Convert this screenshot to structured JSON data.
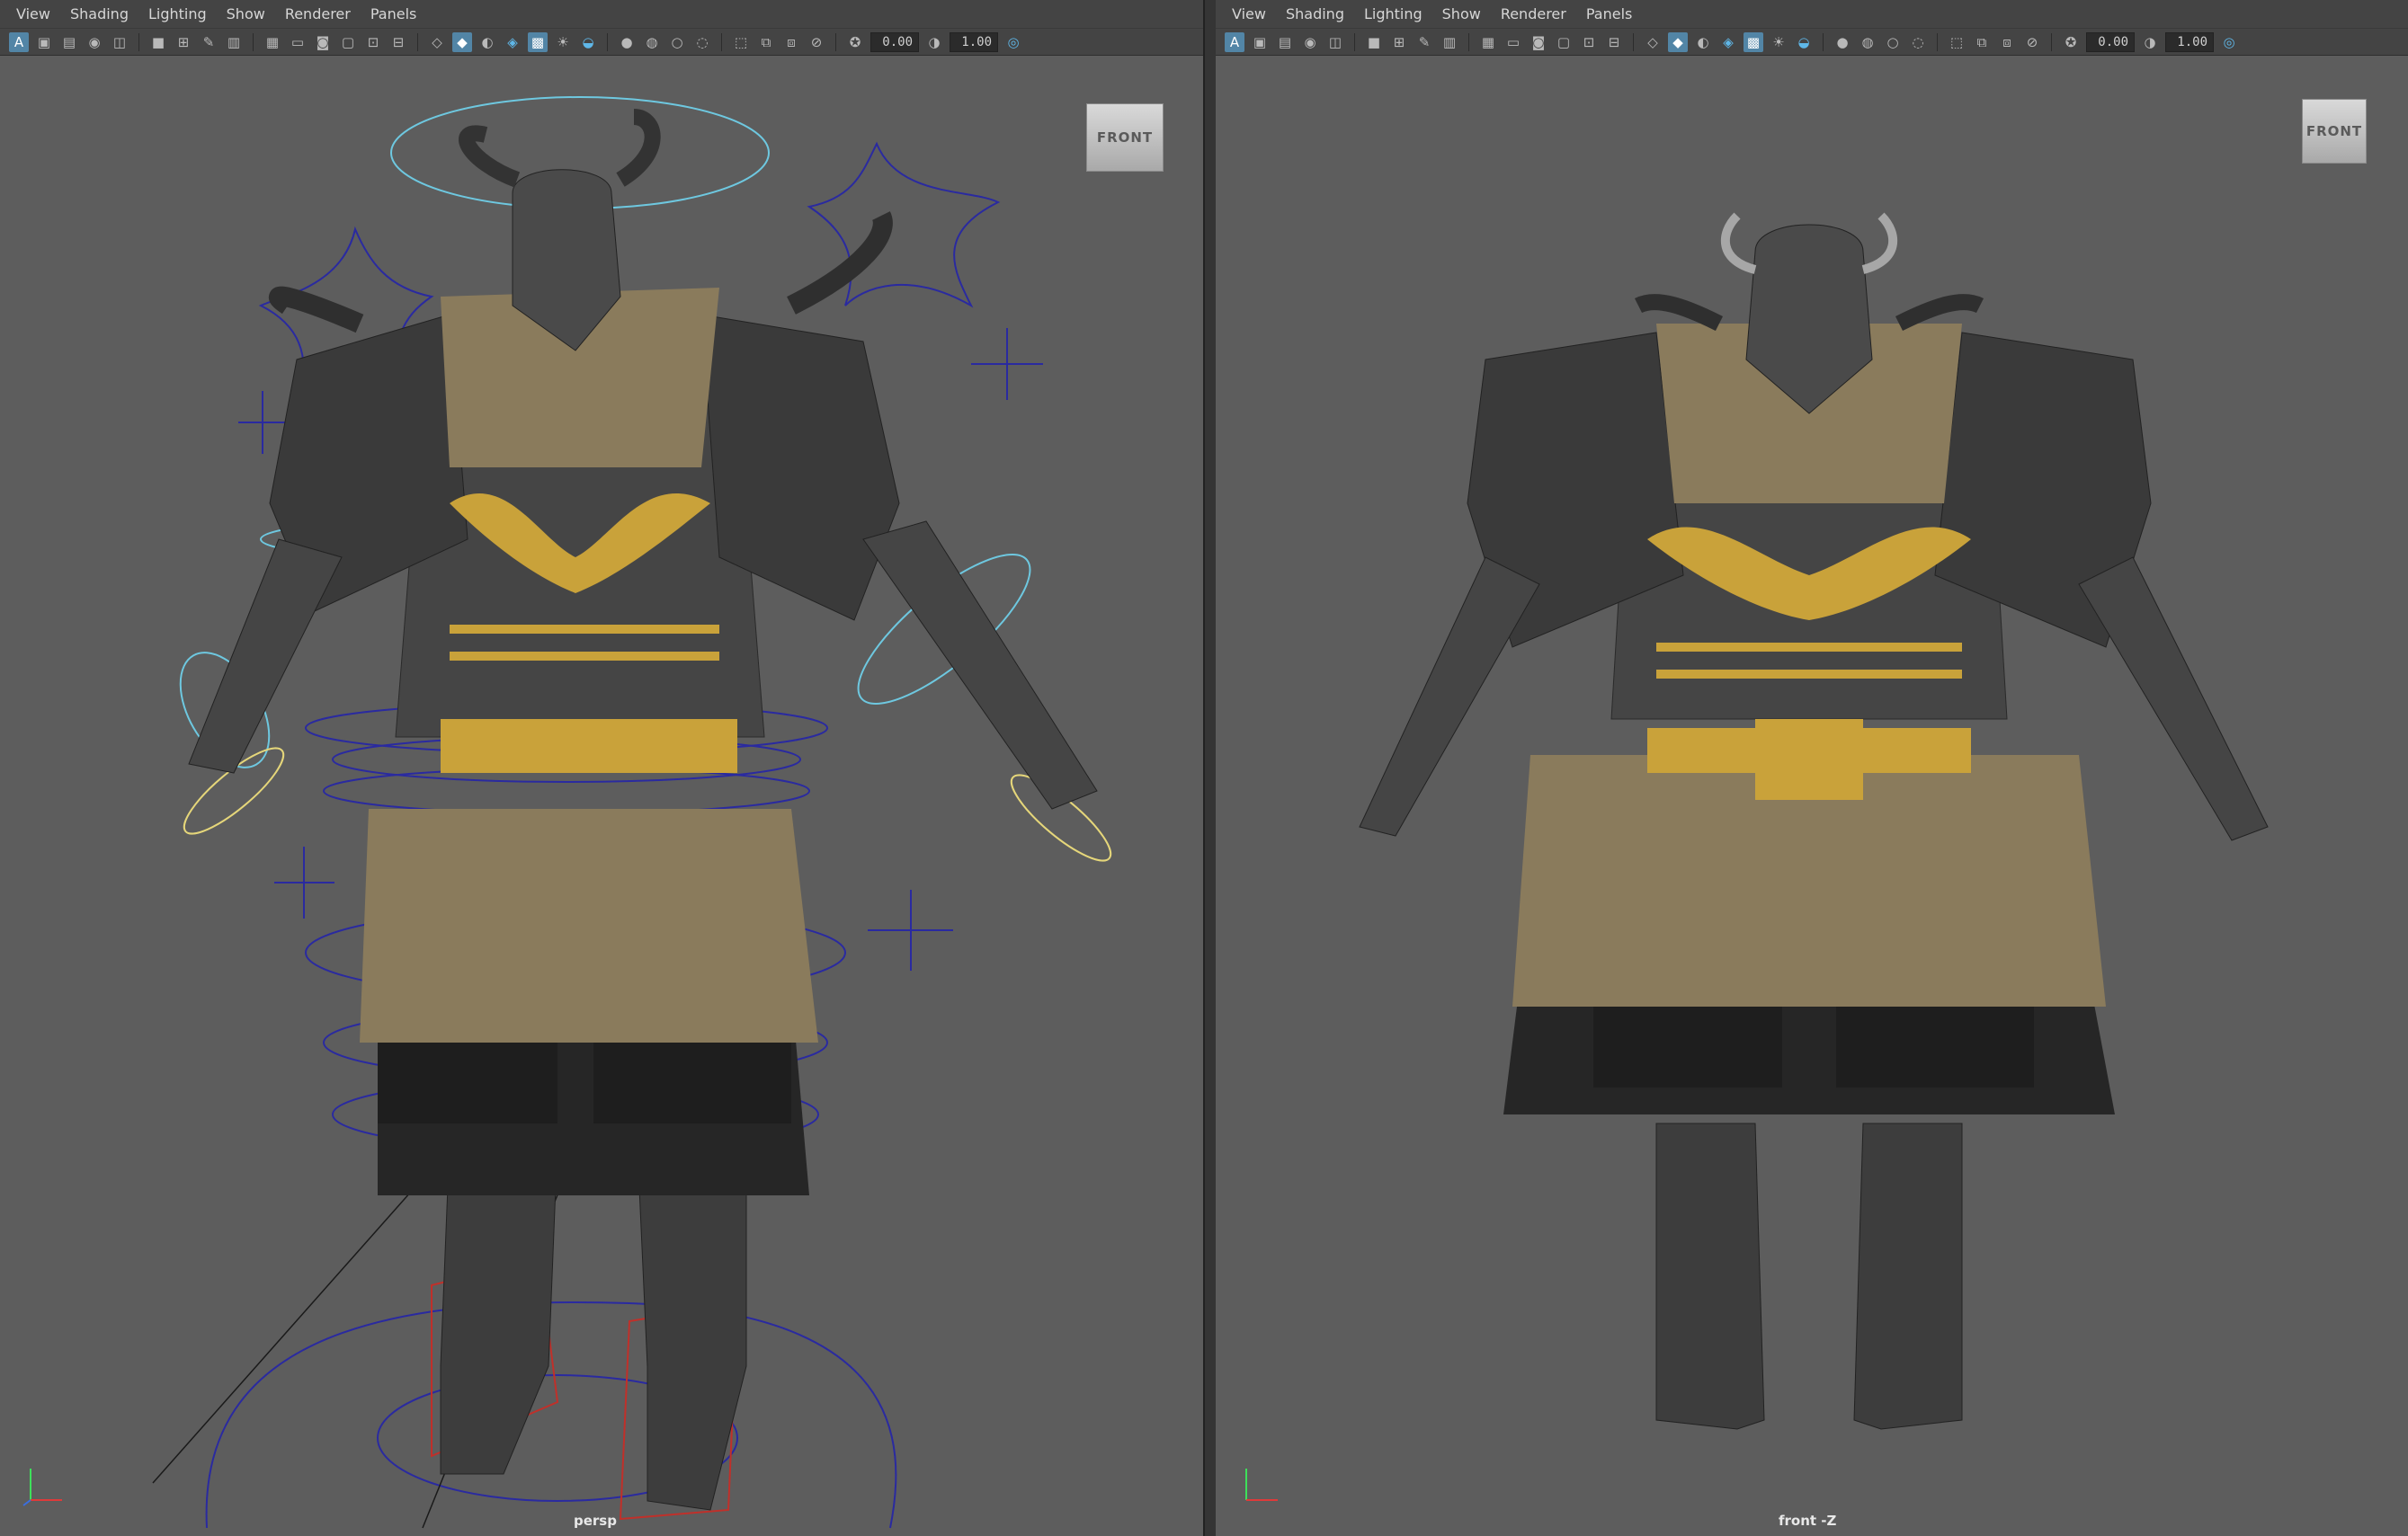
{
  "menus": [
    "View",
    "Shading",
    "Lighting",
    "Show",
    "Renderer",
    "Panels"
  ],
  "toolbar": {
    "field_a": "0.00",
    "field_b": "1.00"
  },
  "viewports": [
    {
      "view_cube": "FRONT",
      "camera": "persp"
    },
    {
      "view_cube": "FRONT",
      "camera": "front -Z"
    }
  ],
  "colors": {
    "viewport_bg": "#5d5d5d",
    "armor_gold": "#c9a23a",
    "armor_dark": "#3a3a3a",
    "fur": "#8a7b5c",
    "control_blue": "#2a2aa0",
    "control_cyan": "#6ec8e0",
    "control_yellow": "#e5d67a",
    "control_red": "#c0302a"
  }
}
